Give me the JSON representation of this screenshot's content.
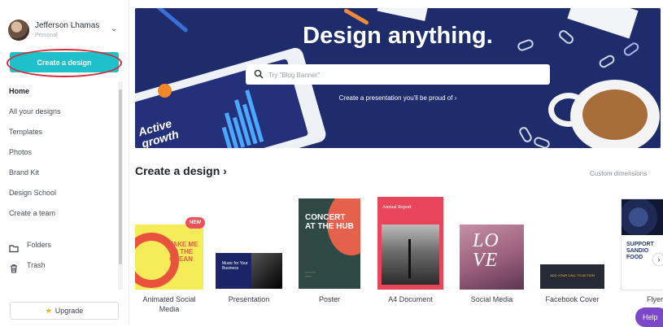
{
  "account": {
    "name": "Jefferson Lhamas",
    "plan": "Personal"
  },
  "sidebar": {
    "create_label": "Create a design",
    "nav": [
      {
        "label": "Home"
      },
      {
        "label": "All your designs"
      },
      {
        "label": "Templates"
      },
      {
        "label": "Photos"
      },
      {
        "label": "Brand Kit"
      },
      {
        "label": "Design School"
      },
      {
        "label": "Create a team"
      }
    ],
    "folders": [
      {
        "label": "Folders",
        "icon": "folder-icon"
      },
      {
        "label": "Trash",
        "icon": "trash-icon"
      }
    ],
    "upgrade_label": "Upgrade"
  },
  "banner": {
    "title": "Design anything.",
    "search_placeholder": "Try \"Blog Banner\"",
    "subtitle": "Create a presentation you'll be proud of ›",
    "tablet_text": "Active\ngrowth"
  },
  "create_section": {
    "title": "Create a design ›",
    "custom_dimensions": "Custom dimensions",
    "new_badge": "NEW",
    "tiles": [
      {
        "label": "Animated Social\nMedia",
        "thumb_text": "TAKE ME TO THE OCEAN"
      },
      {
        "label": "Presentation",
        "thumb_text": "Music for Your Business"
      },
      {
        "label": "Poster",
        "thumb_text": "CONCERT AT THE HUB"
      },
      {
        "label": "A4 Document",
        "thumb_text": "Annual Report"
      },
      {
        "label": "Social Media",
        "thumb_text": "LO VE"
      },
      {
        "label": "Facebook Cover",
        "thumb_text": "ADD YOUR CALL TO ACTION"
      },
      {
        "label": "Flyer",
        "thumb_text": "SUPPORT SANDIO FOOD"
      }
    ]
  },
  "help_label": "Help",
  "colors": {
    "accent": "#1ec0c9",
    "banner_bg": "#1f2c6b",
    "highlight_ring": "#d42b3a",
    "help_bg": "#7a48c9"
  }
}
